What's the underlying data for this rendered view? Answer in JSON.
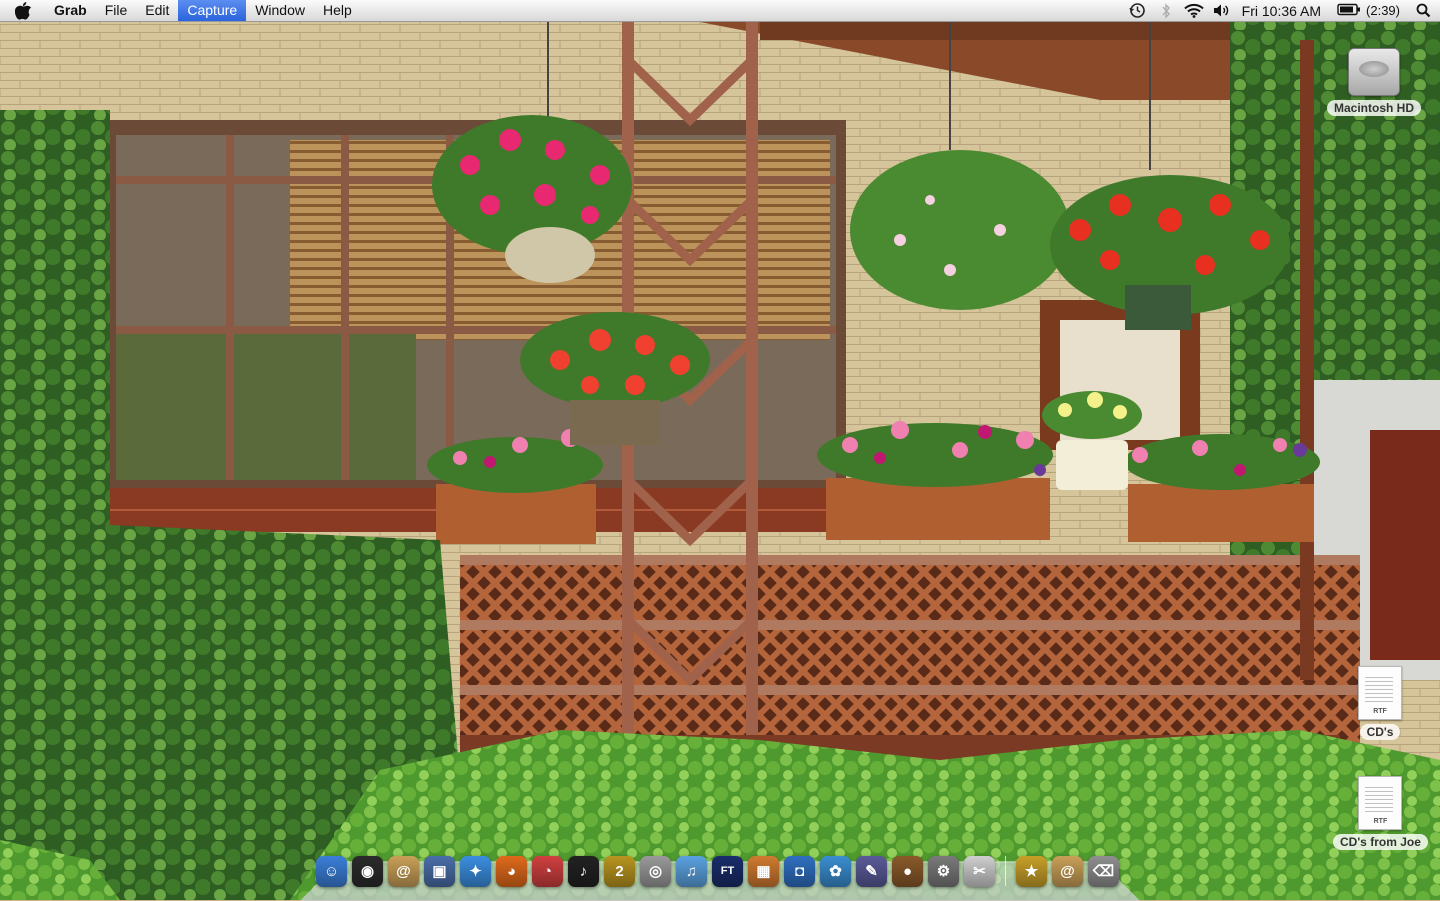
{
  "menubar": {
    "apple_icon": "apple-icon",
    "app_name": "Grab",
    "menus": [
      "File",
      "Edit",
      "Capture",
      "Window",
      "Help"
    ],
    "active_menu": "Capture",
    "status_icons": [
      "time-machine-icon",
      "bluetooth-icon",
      "wifi-icon",
      "volume-icon"
    ],
    "clock": "Fri 10:36 AM",
    "battery_icon": "battery-icon",
    "battery_time": "(2:39)",
    "spotlight_icon": "spotlight-search-icon"
  },
  "desktop": {
    "icons": [
      {
        "label": "Macintosh HD",
        "kind": "hard-drive"
      },
      {
        "label": "CD's",
        "kind": "rtf-file",
        "tag": "RTF"
      },
      {
        "label": "CD's from Joe",
        "kind": "rtf-file",
        "tag": "RTF"
      }
    ]
  },
  "dock": {
    "items": [
      {
        "name": "finder",
        "glyph": "☺",
        "color": "#3b7fd8"
      },
      {
        "name": "dashboard",
        "glyph": "◉",
        "color": "#2b2b2b"
      },
      {
        "name": "address-book",
        "glyph": "@",
        "color": "#c9a058"
      },
      {
        "name": "preview",
        "glyph": "▣",
        "color": "#4a6ea8"
      },
      {
        "name": "safari",
        "glyph": "✦",
        "color": "#3b8fe0"
      },
      {
        "name": "firefox",
        "glyph": "◕",
        "color": "#e06a1b"
      },
      {
        "name": "system-utility",
        "glyph": "◔",
        "color": "#d04040"
      },
      {
        "name": "flip4mac",
        "glyph": "♪",
        "color": "#222222"
      },
      {
        "name": "app-2",
        "glyph": "2",
        "color": "#b89520"
      },
      {
        "name": "dvd-player",
        "glyph": "◎",
        "color": "#9a9a9a"
      },
      {
        "name": "itunes",
        "glyph": "♫",
        "color": "#5ba2e0"
      },
      {
        "name": "full-tilt-poker",
        "glyph": "FT",
        "color": "#1a2d6b"
      },
      {
        "name": "iphoto",
        "glyph": "▦",
        "color": "#d07a30"
      },
      {
        "name": "image-capture",
        "glyph": "◘",
        "color": "#2f6fc0"
      },
      {
        "name": "ichat",
        "glyph": "✿",
        "color": "#3a8ed0"
      },
      {
        "name": "script-editor",
        "glyph": "✎",
        "color": "#5a5a9a"
      },
      {
        "name": "coconut-battery",
        "glyph": "●",
        "color": "#8a5a2a"
      },
      {
        "name": "system-preferences",
        "glyph": "⚙",
        "color": "#7a7a7a"
      },
      {
        "name": "grab",
        "glyph": "✂",
        "color": "#cfcfcf"
      },
      {
        "name": "stuffit",
        "glyph": "★",
        "color": "#c8a028"
      },
      {
        "name": "address-card",
        "glyph": "@",
        "color": "#c9a058"
      },
      {
        "name": "trash",
        "glyph": "⌫",
        "color": "#8f8f8f"
      }
    ],
    "separator_after_index": 18
  },
  "colors": {
    "menu_highlight": "#2a63dc",
    "brick": "#d9c79f",
    "wood": "#8a4a2a",
    "foliage": "#3f7a2a"
  }
}
